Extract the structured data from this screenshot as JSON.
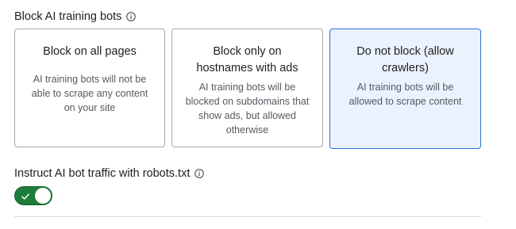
{
  "block_ai_bots": {
    "title": "Block AI training bots",
    "icon": "info-icon",
    "selected_option": "none",
    "options": [
      {
        "id": "all",
        "title": "Block on all pages",
        "description": "AI training bots will not be able to scrape any content on your site",
        "selected": false
      },
      {
        "id": "ads",
        "title": "Block only on hostnames with ads",
        "description": "AI training bots will be blocked on subdomains that show ads, but allowed otherwise",
        "selected": false
      },
      {
        "id": "none",
        "title": "Do not block (allow crawlers)",
        "description": "AI training bots will be allowed to scrape content",
        "selected": true
      }
    ]
  },
  "robots_txt": {
    "title": "Instruct AI bot traffic with robots.txt",
    "icon": "info-icon",
    "toggle_on": true,
    "toggle_icon": "check-icon"
  },
  "colors": {
    "selected_border": "#2a6fd6",
    "selected_bg": "#eaf2fd",
    "toggle_on": "#1c7c3a"
  }
}
